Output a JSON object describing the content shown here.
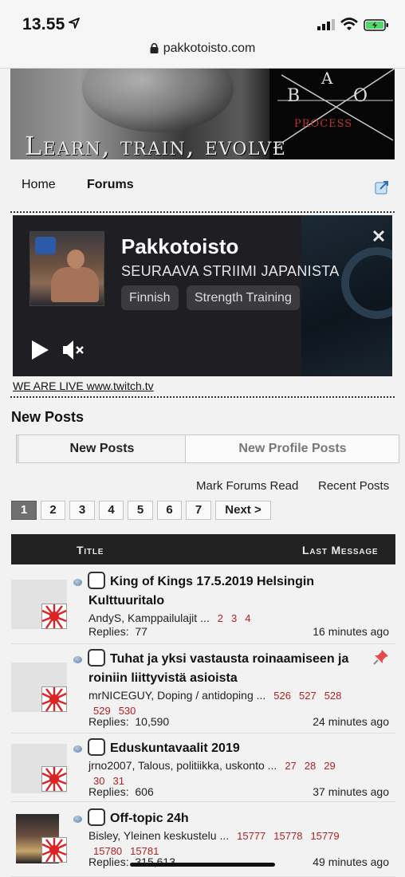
{
  "status": {
    "time": "13.55",
    "url": "pakkotoisto.com"
  },
  "banner": {
    "slogan": "Learn, train, evolve",
    "logo_a": "A",
    "logo_b": "B",
    "logo_o": "O",
    "logo_process": "PROCESS"
  },
  "nav": {
    "home": "Home",
    "forums": "Forums"
  },
  "embed": {
    "channel": "Pakkotoisto",
    "status_text": "SEURAAVA STRIIMI JAPANISTA",
    "tags": [
      "Finnish",
      "Strength Training"
    ],
    "live_link": "WE ARE LIVE www.twitch.tv"
  },
  "section_title": "New Posts",
  "tabs": {
    "new_posts": "New Posts",
    "new_profile_posts": "New Profile Posts"
  },
  "links": {
    "mark_read": "Mark Forums Read",
    "recent": "Recent Posts"
  },
  "pagination": {
    "pages": [
      "1",
      "2",
      "3",
      "4",
      "5",
      "6",
      "7"
    ],
    "current": "1",
    "next": "Next >"
  },
  "table": {
    "col_title": "Title",
    "col_last": "Last Message",
    "replies_label": "Replies:",
    "rows": [
      {
        "title": "King of Kings 17.5.2019 Helsingin Kulttuuritalo",
        "author_forum": "AndyS, Kamppailulajit  ...",
        "pages": [
          "2",
          "3",
          "4"
        ],
        "replies": "77",
        "last": "16 minutes ago",
        "pinned": false
      },
      {
        "title": "Tuhat ja yksi vastausta roinaamiseen ja roiniin liittyvistä asioista",
        "author_forum": "mrNICEGUY, Doping / antidoping  ...",
        "pages": [
          "526",
          "527",
          "528",
          "529",
          "530"
        ],
        "replies": "10,590",
        "last": "24 minutes ago",
        "pinned": true
      },
      {
        "title": "Eduskuntavaalit 2019",
        "author_forum": "jrno2007, Talous, politiikka, uskonto  ...",
        "pages": [
          "27",
          "28",
          "29",
          "30",
          "31"
        ],
        "replies": "606",
        "last": "37 minutes ago",
        "pinned": false
      },
      {
        "title": "Off-topic 24h",
        "author_forum": "Bisley, Yleinen keskustelu  ...",
        "pages": [
          "15777",
          "15778",
          "15779",
          "15780",
          "15781"
        ],
        "replies": "315,613",
        "last": "49 minutes ago",
        "pinned": false
      }
    ]
  },
  "icons": [
    "location-arrow-icon",
    "signal-icon",
    "wifi-icon",
    "battery-icon",
    "lock-icon",
    "external-link-icon",
    "close-icon",
    "play-icon",
    "mute-icon",
    "rising-sun-flag-icon",
    "status-dot-icon",
    "pin-icon"
  ],
  "colors": {
    "page_link": "#b32222",
    "table_header": "#222222",
    "current_page": "#6f6f6f"
  }
}
